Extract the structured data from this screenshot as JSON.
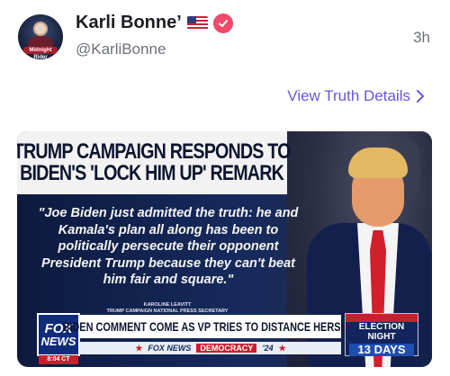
{
  "post": {
    "author_name": "Karli Bonne’",
    "handle": "@KarliBonne",
    "time_ago": "3h",
    "avatar_text": "Midnight Rider",
    "view_details_label": "View Truth Details",
    "badges": {
      "flag": "us-flag-icon",
      "verified": "verified-icon",
      "verified_color": "#f04a6a"
    }
  },
  "media": {
    "headline_line1": "TRUMP CAMPAIGN RESPONDS TO",
    "headline_line2": "BIDEN'S 'LOCK HIM UP' REMARK",
    "quote": "\"Joe Biden just admitted the truth: he and Kamala's plan all along has been to politically persecute their opponent President Trump because they can't beat him fair and square.\"",
    "attribution_name": "KAROLINE LEAVITT",
    "attribution_title": "TRUMP CAMPAIGN NATIONAL PRESS SECRETARY",
    "logo_line1": "FOX",
    "logo_line2": "NEWS",
    "clock": "8:04 CT",
    "ticker_main": "BIDEN COMMENT COME AS VP TRIES TO DISTANCE HERSELF",
    "ticker_sub_brand": "FOX NEWS",
    "ticker_sub_democracy": "DEMOCRACY",
    "ticker_sub_year": "'24",
    "countdown_top": "",
    "countdown_label1": "ELECTION",
    "countdown_label2": "NIGHT",
    "countdown_days": "13 DAYS"
  },
  "colors": {
    "link": "#6a55d9",
    "text_primary": "#1c1c22",
    "text_secondary": "#6b6f78"
  }
}
